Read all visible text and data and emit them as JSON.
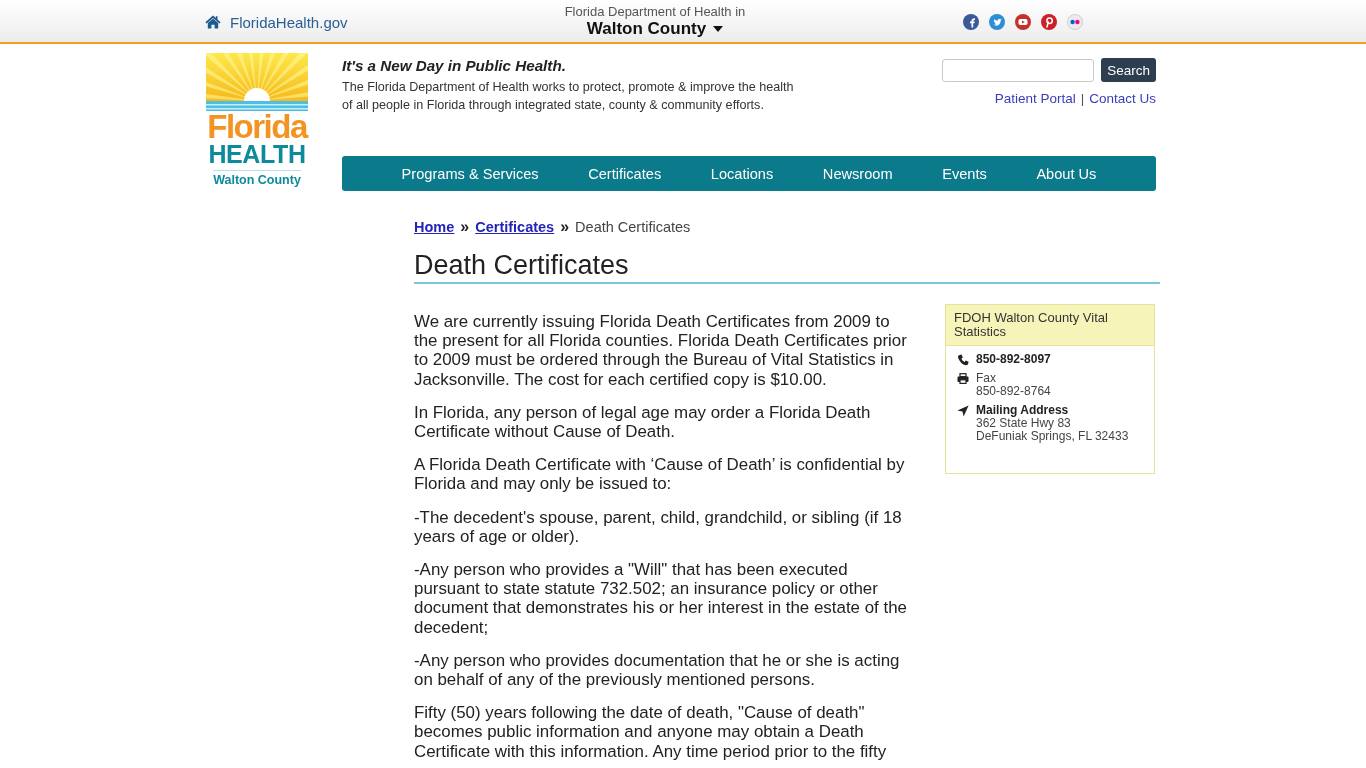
{
  "top_bar": {
    "home_link": "FloridaHealth.gov",
    "department": "Florida Department of Health in",
    "county": "Walton County"
  },
  "logo": {
    "line_1": "Florida",
    "line_2": "HEALTH",
    "line_3": "Walton County"
  },
  "header": {
    "tagline": "It's a New Day in Public Health.",
    "description": "The Florida Department of Health works to protect, promote & improve the health of all people in Florida through integrated state, county & community efforts.",
    "search": {
      "button": "Search"
    },
    "links": [
      "Patient Portal",
      "Contact Us"
    ],
    "link_separator": "|"
  },
  "nav": {
    "items": [
      "Programs & Services",
      "Certificates",
      "Locations",
      "Newsroom",
      "Events",
      "About Us"
    ]
  },
  "breadcrumb": [
    {
      "kind": "link",
      "text": "Home"
    },
    {
      "kind": "separator",
      "text": "»"
    },
    {
      "kind": "link",
      "text": "Certificates"
    },
    {
      "kind": "separator",
      "text": "»"
    },
    {
      "kind": "current",
      "text": "Death Certificates"
    }
  ],
  "page_title": "Death Certificates",
  "paragraphs": [
    "We are currently issuing Florida Death Certificates from 2009 to the present for all Florida counties. Florida Death Certificates prior to 2009 must be ordered through the Bureau of Vital Statistics in Jacksonville. The cost for each certified copy is $10.00.",
    "In Florida, any person of legal age may order a Florida Death Certificate without Cause of Death.",
    "A Florida Death Certificate with ‘Cause of Death’ is confidential by Florida and may only be issued to:",
    "-The decedent's spouse, parent, child, grandchild, or sibling (if 18 years of age or older).",
    "-Any person who provides a \"Will\" that has been executed pursuant to state statute 732.502; an insurance policy or other document that demonstrates his or her interest in the estate of the decedent;",
    "-Any person who provides documentation that he or she is acting on behalf of any of the previously mentioned persons.",
    "Fifty (50) years following the date of death, \"Cause of death\" becomes public information and anyone may obtain a Death Certificate with this information. Any time period prior to the fifty"
  ],
  "contact_card": {
    "title": "FDOH Walton County Vital Statistics",
    "entries": [
      {
        "kind": "phone",
        "value": "850-892-8097"
      },
      {
        "kind": "fax",
        "label": "Fax",
        "value": "850-892-8764"
      },
      {
        "kind": "address",
        "label": "Mailing Address",
        "lines": [
          "362 State Hwy 83",
          "DeFuniak Springs, FL 32433"
        ]
      }
    ]
  }
}
